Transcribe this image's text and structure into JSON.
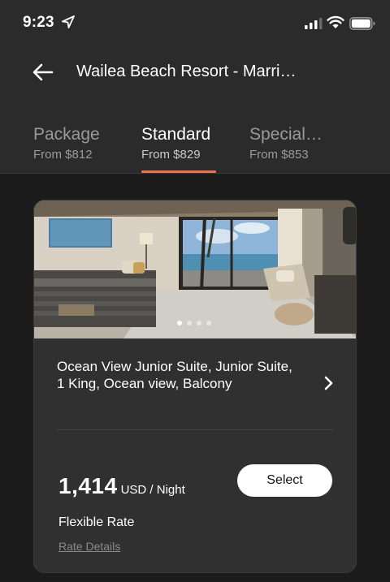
{
  "status_bar": {
    "time": "9:23",
    "icons": [
      "location-arrow-icon",
      "cellular-signal-icon",
      "wifi-icon",
      "battery-icon"
    ]
  },
  "nav": {
    "back_icon": "arrow-left-icon",
    "title": "Wailea Beach Resort - Marri…"
  },
  "tabs": [
    {
      "name": "Package",
      "price": "From $812",
      "active": false
    },
    {
      "name": "Standard",
      "price": "From $829",
      "active": true
    },
    {
      "name": "Special…",
      "price": "From $853",
      "active": false
    }
  ],
  "room": {
    "photo_count": 4,
    "photo_index": 1,
    "name": "Ocean View Junior Suite, Junior Suite, 1 King, Ocean view, Balcony",
    "price_amount": "1,414",
    "price_unit": "USD / Night",
    "select_label": "Select",
    "rate_name": "Flexible Rate",
    "rate_details_label": "Rate Details"
  },
  "colors": {
    "background": "#1c1c1c",
    "header": "#2b2b2b",
    "card": "#303030",
    "accent": "#e8724a",
    "muted_text": "#9a9a9a"
  }
}
